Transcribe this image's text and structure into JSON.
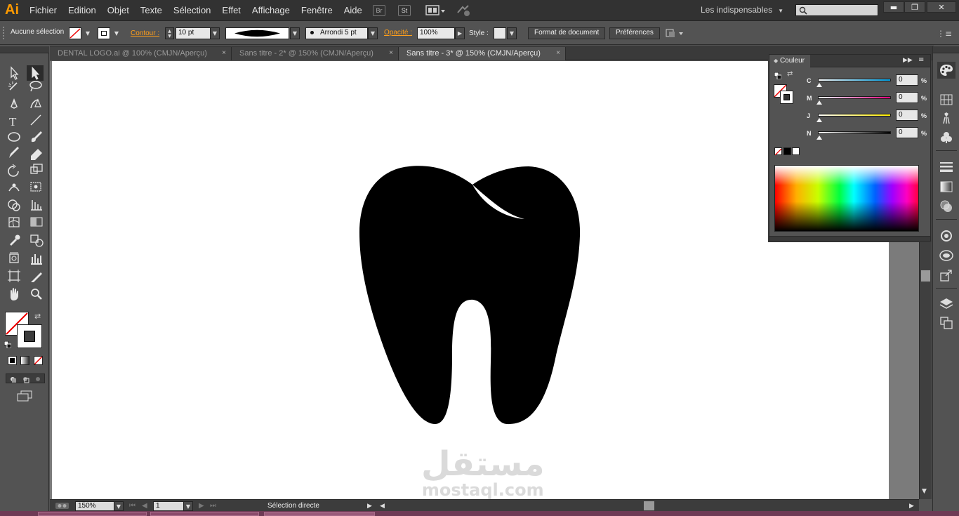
{
  "app": {
    "logo": "Ai"
  },
  "menu": {
    "items": [
      "Fichier",
      "Edition",
      "Objet",
      "Texte",
      "Sélection",
      "Effet",
      "Affichage",
      "Fenêtre",
      "Aide"
    ]
  },
  "menubar_icons": {
    "bridge": "Br",
    "stock": "St",
    "arrange_icon": "arrange-documents-icon",
    "sync_icon": "sync-settings-icon"
  },
  "workspace": {
    "label": "Les indispensables"
  },
  "search": {
    "placeholder": ""
  },
  "window_controls": {
    "minimize": "▬",
    "restore": "❐",
    "close": "✕"
  },
  "controlbar": {
    "selection_label": "Aucune sélection",
    "stroke_label": "Contour :",
    "stroke_value": "10 pt",
    "brush_value": "Arrondi 5 pt",
    "opacity_label": "Opacité :",
    "opacity_value": "100%",
    "style_label": "Style :",
    "doc_format_button": "Format de document",
    "preferences_button": "Préférences"
  },
  "tabs": [
    {
      "label": "DENTAL LOGO.ai @ 100% (CMJN/Aperçu)",
      "active": false
    },
    {
      "label": "Sans titre - 2* @ 150% (CMJN/Aperçu)",
      "active": false
    },
    {
      "label": "Sans titre - 3* @ 150% (CMJN/Aperçu)",
      "active": true
    }
  ],
  "tab_close_glyph": "×",
  "color_panel": {
    "title": "Couleur",
    "sliders": [
      {
        "label": "C",
        "value": "0",
        "unit": "%",
        "gradient": [
          "#ffffff",
          "#00a0e3"
        ]
      },
      {
        "label": "M",
        "value": "0",
        "unit": "%",
        "gradient": [
          "#ffffff",
          "#e6007e"
        ]
      },
      {
        "label": "J",
        "value": "0",
        "unit": "%",
        "gradient": [
          "#ffffff",
          "#ffed00"
        ]
      },
      {
        "label": "N",
        "value": "0",
        "unit": "%",
        "gradient": [
          "#ffffff",
          "#000000"
        ]
      }
    ]
  },
  "statusbar": {
    "zoom": "150%",
    "artboard": "1",
    "tool_name": "Sélection directe"
  },
  "watermark": {
    "arabic": "مستقل",
    "latin": "mostaql.com"
  },
  "colors": {
    "accent_orange": "#ff9a00",
    "artwork": "#000000",
    "chrome_dark": "#323232",
    "chrome_mid": "#535353"
  }
}
